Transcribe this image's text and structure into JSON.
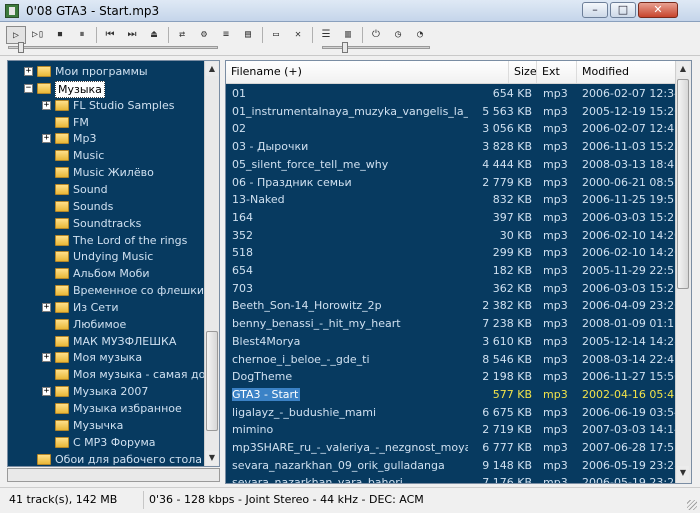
{
  "window": {
    "title": "0'08 GTA3 - Start.mp3"
  },
  "window_buttons": {
    "minimize": "–",
    "maximize": "□",
    "close": "✕"
  },
  "toolbar": {
    "buttons": [
      {
        "name": "play-button",
        "glyph": "▷"
      },
      {
        "name": "play-next-button",
        "glyph": "▷▯"
      },
      {
        "name": "stop-button",
        "glyph": "⏹"
      },
      {
        "name": "pause-button",
        "glyph": "⏸"
      },
      {
        "name": "previous-button",
        "glyph": "⏮"
      },
      {
        "name": "next-button",
        "glyph": "⏭"
      },
      {
        "name": "open-button",
        "glyph": "⏏"
      },
      {
        "name": "shuffle-button",
        "glyph": "⇄"
      },
      {
        "name": "options-button",
        "glyph": "⚙"
      },
      {
        "name": "queue-button",
        "glyph": "≡"
      },
      {
        "name": "file-button",
        "glyph": "▤"
      },
      {
        "name": "list-button",
        "glyph": "▭"
      },
      {
        "name": "delete-button",
        "glyph": "✕"
      },
      {
        "name": "playlist-button",
        "glyph": "☰"
      },
      {
        "name": "info-button",
        "glyph": "▥"
      },
      {
        "name": "power-button",
        "glyph": "⏻"
      },
      {
        "name": "timer-button",
        "glyph": "◷"
      },
      {
        "name": "visualize-button",
        "glyph": "◔"
      }
    ],
    "seek_position": 0.05,
    "volume_level": 0.2
  },
  "tree": {
    "items": [
      {
        "label": "Мои программы",
        "level": 1,
        "expander": "+"
      },
      {
        "label": "Музыка",
        "level": 1,
        "expander": "−",
        "selected": true
      },
      {
        "label": "FL Studio Samples",
        "level": 2,
        "expander": "+"
      },
      {
        "label": "FM",
        "level": 2,
        "expander": ""
      },
      {
        "label": "Mp3",
        "level": 2,
        "expander": "+"
      },
      {
        "label": "Music",
        "level": 2,
        "expander": ""
      },
      {
        "label": "Music Жилёво",
        "level": 2,
        "expander": ""
      },
      {
        "label": "Sound",
        "level": 2,
        "expander": ""
      },
      {
        "label": "Sounds",
        "level": 2,
        "expander": ""
      },
      {
        "label": "Soundtracks",
        "level": 2,
        "expander": ""
      },
      {
        "label": "The Lord of the rings",
        "level": 2,
        "expander": ""
      },
      {
        "label": "Undying Music",
        "level": 2,
        "expander": ""
      },
      {
        "label": "Альбом Моби",
        "level": 2,
        "expander": ""
      },
      {
        "label": "Временное со флешки",
        "level": 2,
        "expander": ""
      },
      {
        "label": "Из Сети",
        "level": 2,
        "expander": "+"
      },
      {
        "label": "Любимое",
        "level": 2,
        "expander": ""
      },
      {
        "label": "МАК МУЗФЛЕШКА",
        "level": 2,
        "expander": ""
      },
      {
        "label": "Моя музыка",
        "level": 2,
        "expander": "+"
      },
      {
        "label": "Моя музыка - самая долго",
        "level": 2,
        "expander": ""
      },
      {
        "label": "Музыка 2007",
        "level": 2,
        "expander": "+"
      },
      {
        "label": "Музыка избранное",
        "level": 2,
        "expander": ""
      },
      {
        "label": "Музычка",
        "level": 2,
        "expander": ""
      },
      {
        "label": "С MP3 Форума",
        "level": 2,
        "expander": ""
      },
      {
        "label": "Обои для рабочего стола",
        "level": 1,
        "expander": ""
      }
    ]
  },
  "list": {
    "columns": {
      "filename": "Filename (+)",
      "size": "Size",
      "ext": "Ext",
      "modified": "Modified"
    },
    "rows": [
      {
        "name": "01",
        "size": "654 KB",
        "ext": "mp3",
        "modified": "2006-02-07 12:34"
      },
      {
        "name": "01_instrumentalnaya_muzyka_vangelis_la_pet...",
        "size": "5 563 KB",
        "ext": "mp3",
        "modified": "2005-12-19 15:26"
      },
      {
        "name": "02",
        "size": "3 056 KB",
        "ext": "mp3",
        "modified": "2006-02-07 12:47"
      },
      {
        "name": "03 - Дырочки",
        "size": "3 828 KB",
        "ext": "mp3",
        "modified": "2006-11-03 15:22"
      },
      {
        "name": "05_silent_force_tell_me_why",
        "size": "4 444 KB",
        "ext": "mp3",
        "modified": "2008-03-13 18:41"
      },
      {
        "name": "06 - Праздник семьи",
        "size": "2 779 KB",
        "ext": "mp3",
        "modified": "2000-06-21 08:52"
      },
      {
        "name": "13-Naked",
        "size": "832 KB",
        "ext": "mp3",
        "modified": "2006-11-25 19:55"
      },
      {
        "name": "164",
        "size": "397 KB",
        "ext": "mp3",
        "modified": "2006-03-03 15:23"
      },
      {
        "name": "352",
        "size": "30 KB",
        "ext": "mp3",
        "modified": "2006-02-10 14:20"
      },
      {
        "name": "518",
        "size": "299 KB",
        "ext": "mp3",
        "modified": "2006-02-10 14:26"
      },
      {
        "name": "654",
        "size": "182 KB",
        "ext": "mp3",
        "modified": "2005-11-29 22:57"
      },
      {
        "name": "703",
        "size": "362 KB",
        "ext": "mp3",
        "modified": "2006-03-03 15:21"
      },
      {
        "name": "Beeth_Son-14_Horowitz_2p",
        "size": "2 382 KB",
        "ext": "mp3",
        "modified": "2006-04-09 23:26"
      },
      {
        "name": "benny_benassi_-_hit_my_heart",
        "size": "7 238 KB",
        "ext": "mp3",
        "modified": "2008-01-09 01:17"
      },
      {
        "name": "Blest4Morya",
        "size": "3 610 KB",
        "ext": "mp3",
        "modified": "2005-12-14 14:28"
      },
      {
        "name": "chernoe_i_beloe_-_gde_ti",
        "size": "8 546 KB",
        "ext": "mp3",
        "modified": "2008-03-14 22:45"
      },
      {
        "name": "DogTheme",
        "size": "2 198 KB",
        "ext": "mp3",
        "modified": "2006-11-27 15:56"
      },
      {
        "name": "GTA3 - Start",
        "size": "577 KB",
        "ext": "mp3",
        "modified": "2002-04-16 05:45",
        "playing": true
      },
      {
        "name": "ligalayz_-_budushie_mami",
        "size": "6 675 KB",
        "ext": "mp3",
        "modified": "2006-06-19 03:54"
      },
      {
        "name": "mimino",
        "size": "2 719 KB",
        "ext": "mp3",
        "modified": "2007-03-03 14:14"
      },
      {
        "name": "mp3SHARE_ru_-_valeriya_-_nezgnost_moya",
        "size": "6 777 KB",
        "ext": "mp3",
        "modified": "2007-06-28 17:55"
      },
      {
        "name": "sevara_nazarkhan_09_orik_gulladanga",
        "size": "9 148 KB",
        "ext": "mp3",
        "modified": "2006-05-19 23:28"
      },
      {
        "name": "sevara_nazarkhan_yara_bahori",
        "size": "7 176 KB",
        "ext": "mp3",
        "modified": "2006-05-19 23:25"
      }
    ]
  },
  "status": {
    "tracks": "41 track(s), 142 MB",
    "stream": "0'36 - 128 kbps - Joint Stereo - 44 kHz - DEC: ACM"
  },
  "colors": {
    "panel_bg": "#073a60",
    "text": "#cfe0f0",
    "playing_highlight": "#3b82c6",
    "playing_text": "#f2e34a"
  }
}
